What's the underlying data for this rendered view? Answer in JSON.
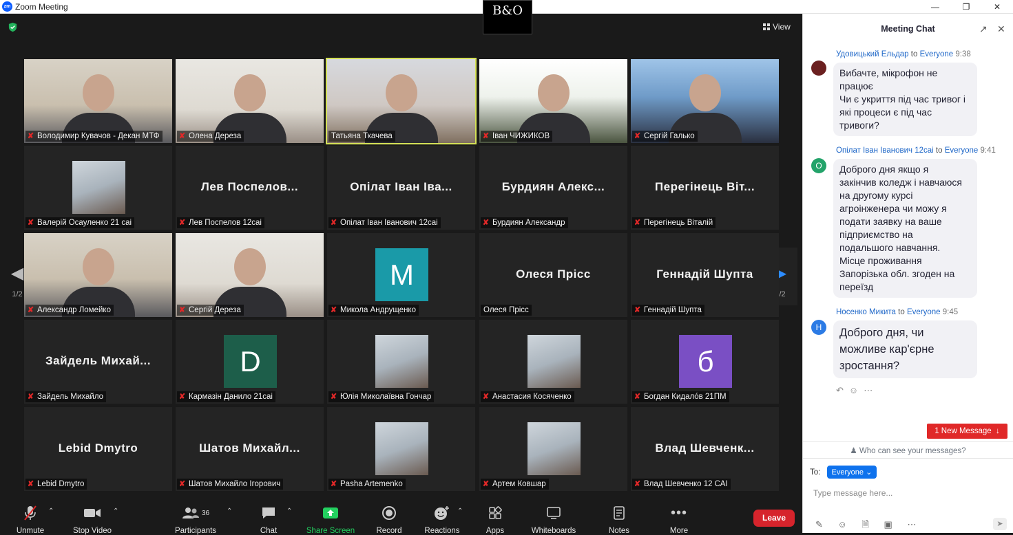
{
  "window": {
    "title": "Zoom Meeting",
    "app_icon": "zm",
    "controls": [
      "minimize-icon",
      "restore-icon",
      "close-icon"
    ]
  },
  "meeting": {
    "view_label": "View",
    "page_indicator": "1/2",
    "logo_text": "B&O",
    "tiles": [
      {
        "name": "Володимир Кувачов - Декан МТФ",
        "muted": true,
        "type": "video"
      },
      {
        "name": "Олена Дереза",
        "muted": true,
        "type": "video"
      },
      {
        "name": "Татьяна Ткачева",
        "muted": false,
        "type": "video",
        "active": true
      },
      {
        "name": "Іван ЧИЖИКОВ",
        "muted": true,
        "type": "video"
      },
      {
        "name": "Сергій Галько",
        "muted": true,
        "type": "video"
      },
      {
        "name": "Валерій Осауленко 21 саі",
        "muted": true,
        "type": "photo"
      },
      {
        "name": "Лев Поспелов 12саі",
        "muted": true,
        "type": "text",
        "display": "Лев Поспелов..."
      },
      {
        "name": "Опілат Іван Іванович 12саі",
        "muted": true,
        "type": "text",
        "display": "Опілат Іван Іва..."
      },
      {
        "name": "Бурдиян Александр",
        "muted": true,
        "type": "text",
        "display": "Бурдиян Алекс..."
      },
      {
        "name": "Перегінець Віталій",
        "muted": true,
        "type": "text",
        "display": "Перегінець Віт..."
      },
      {
        "name": "Александр Ломейко",
        "muted": true,
        "type": "video"
      },
      {
        "name": "Сергій Дереза",
        "muted": true,
        "type": "video"
      },
      {
        "name": "Микола Андрущенко",
        "muted": true,
        "type": "avatar",
        "letter": "M",
        "color": "#1a9aa8"
      },
      {
        "name": "Олеся Прісс",
        "muted": false,
        "type": "text",
        "display": "Олеся Прісс"
      },
      {
        "name": "Геннадій Шупта",
        "muted": true,
        "type": "text",
        "display": "Геннадій Шупта"
      },
      {
        "name": "Зайдель Михайло",
        "muted": true,
        "type": "text",
        "display": "Зайдель Михай..."
      },
      {
        "name": "Кармазін Данило 21саі",
        "muted": true,
        "type": "avatar",
        "letter": "D",
        "color": "#1d5e4a"
      },
      {
        "name": "Юлія Миколаївна Гончар",
        "muted": true,
        "type": "photo"
      },
      {
        "name": "Анастасия Косяченко",
        "muted": true,
        "type": "photo"
      },
      {
        "name": "Богдан Кидалóв 21ПМ",
        "muted": true,
        "type": "avatar",
        "letter": "б",
        "color": "#7a4fc4"
      },
      {
        "name": "Lebid Dmytro",
        "muted": true,
        "type": "text",
        "display": "Lebid Dmytro"
      },
      {
        "name": "Шатов Михайло  Ігорович",
        "muted": true,
        "type": "text",
        "display": "Шатов Михайл..."
      },
      {
        "name": "Pasha Artemenko",
        "muted": true,
        "type": "photo"
      },
      {
        "name": "Артем Ковшар",
        "muted": true,
        "type": "photo"
      },
      {
        "name": "Влад Шевченко 12 САІ",
        "muted": true,
        "type": "text",
        "display": "Влад Шевченк..."
      }
    ]
  },
  "toolbar": {
    "unmute": "Unmute",
    "stop_video": "Stop Video",
    "participants": "Participants",
    "participants_count": "36",
    "chat": "Chat",
    "share_screen": "Share Screen",
    "record": "Record",
    "reactions": "Reactions",
    "apps": "Apps",
    "whiteboards": "Whiteboards",
    "notes": "Notes",
    "more": "More",
    "leave": "Leave",
    "accent_green": "#23d160",
    "leave_color": "#d6242c"
  },
  "chat": {
    "title": "Meeting Chat",
    "messages": [
      {
        "sender": "Удовицький Ельдар",
        "to_word": "to",
        "recipient": "Everyone",
        "time": "9:38",
        "lines": [
          "Вибачте, мікрофон не",
          "працює",
          "Чи є укриття під час тривог і",
          "які процеси є під час",
          "тривоги?"
        ]
      },
      {
        "sender": "Опілат Іван Іванович 12саі",
        "to_word": "to",
        "recipient": "Everyone",
        "time": "9:41",
        "avatar_letter": "O",
        "lines": [
          "Доброго дня якщо я",
          "закінчив коледж і навчаюся",
          "на другому курсі",
          "агроінженера чи можу я",
          "подати заявку на ваше",
          "підприємство на",
          "подальшого навчання.",
          "Місце проживання",
          "Запорізька обл. згоден на",
          "переїзд"
        ]
      },
      {
        "sender": "Носенко Микита",
        "to_word": "to",
        "recipient": "Everyone",
        "time": "9:45",
        "avatar_letter": "H",
        "lines": [
          "Доброго дня, чи",
          "можливе кар'єрне",
          "зростання?"
        ]
      }
    ],
    "new_message_label": "1 New Message",
    "who_can_see": "Who can see your messages?",
    "to_label": "To:",
    "recipient_select": "Everyone",
    "input_placeholder": "Type message here..."
  }
}
